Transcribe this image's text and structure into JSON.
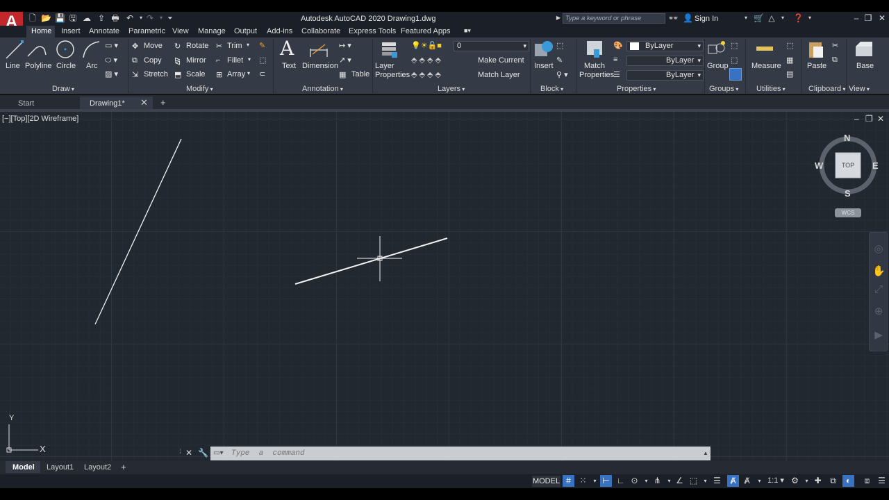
{
  "titlebar": {
    "title": "Autodesk AutoCAD 2020   Drawing1.dwg",
    "search_placeholder": "Type a keyword or phrase",
    "sign_in": "Sign In"
  },
  "ribbon_tabs": [
    "Home",
    "Insert",
    "Annotate",
    "Parametric",
    "View",
    "Manage",
    "Output",
    "Add-ins",
    "Collaborate",
    "Express Tools",
    "Featured Apps"
  ],
  "draw": {
    "title": "Draw",
    "line": "Line",
    "polyline": "Polyline",
    "circle": "Circle",
    "arc": "Arc"
  },
  "modify": {
    "title": "Modify",
    "move": "Move",
    "rotate": "Rotate",
    "trim": "Trim",
    "copy": "Copy",
    "mirror": "Mirror",
    "fillet": "Fillet",
    "stretch": "Stretch",
    "scale": "Scale",
    "array": "Array"
  },
  "annotation": {
    "title": "Annotation",
    "text": "Text",
    "dimension": "Dimension",
    "table": "Table"
  },
  "layers": {
    "title": "Layers",
    "layer_properties_1": "Layer",
    "layer_properties_2": "Properties",
    "current_layer": "0",
    "make_current": "Make Current",
    "match_layer": "Match Layer"
  },
  "block": {
    "title": "Block",
    "insert": "Insert"
  },
  "properties": {
    "title": "Properties",
    "match_1": "Match",
    "match_2": "Properties",
    "color": "ByLayer",
    "linetype": "ByLayer",
    "lineweight": "ByLayer"
  },
  "groups": {
    "title": "Groups",
    "group": "Group"
  },
  "utilities": {
    "title": "Utilities",
    "measure": "Measure"
  },
  "clipboard": {
    "title": "Clipboard",
    "paste": "Paste"
  },
  "view_panel": {
    "title": "View",
    "base": "Base"
  },
  "file_tabs": {
    "start": "Start",
    "drawing": "Drawing1*"
  },
  "viewport": {
    "label": "[−][Top][2D Wireframe]"
  },
  "viewcube": {
    "n": "N",
    "s": "S",
    "e": "E",
    "w": "W",
    "face": "TOP",
    "wcs": "WCS"
  },
  "ucs": {
    "x": "X",
    "y": "Y"
  },
  "command": {
    "placeholder": "Type  a  command"
  },
  "layout_tabs": {
    "model": "Model",
    "layout1": "Layout1",
    "layout2": "Layout2"
  },
  "status": {
    "model": "MODEL",
    "scale": "1:1"
  },
  "colors": {
    "accent": "#3872c2",
    "logo": "#c3272b",
    "canvas": "#212830",
    "ribbon": "#353b46"
  }
}
